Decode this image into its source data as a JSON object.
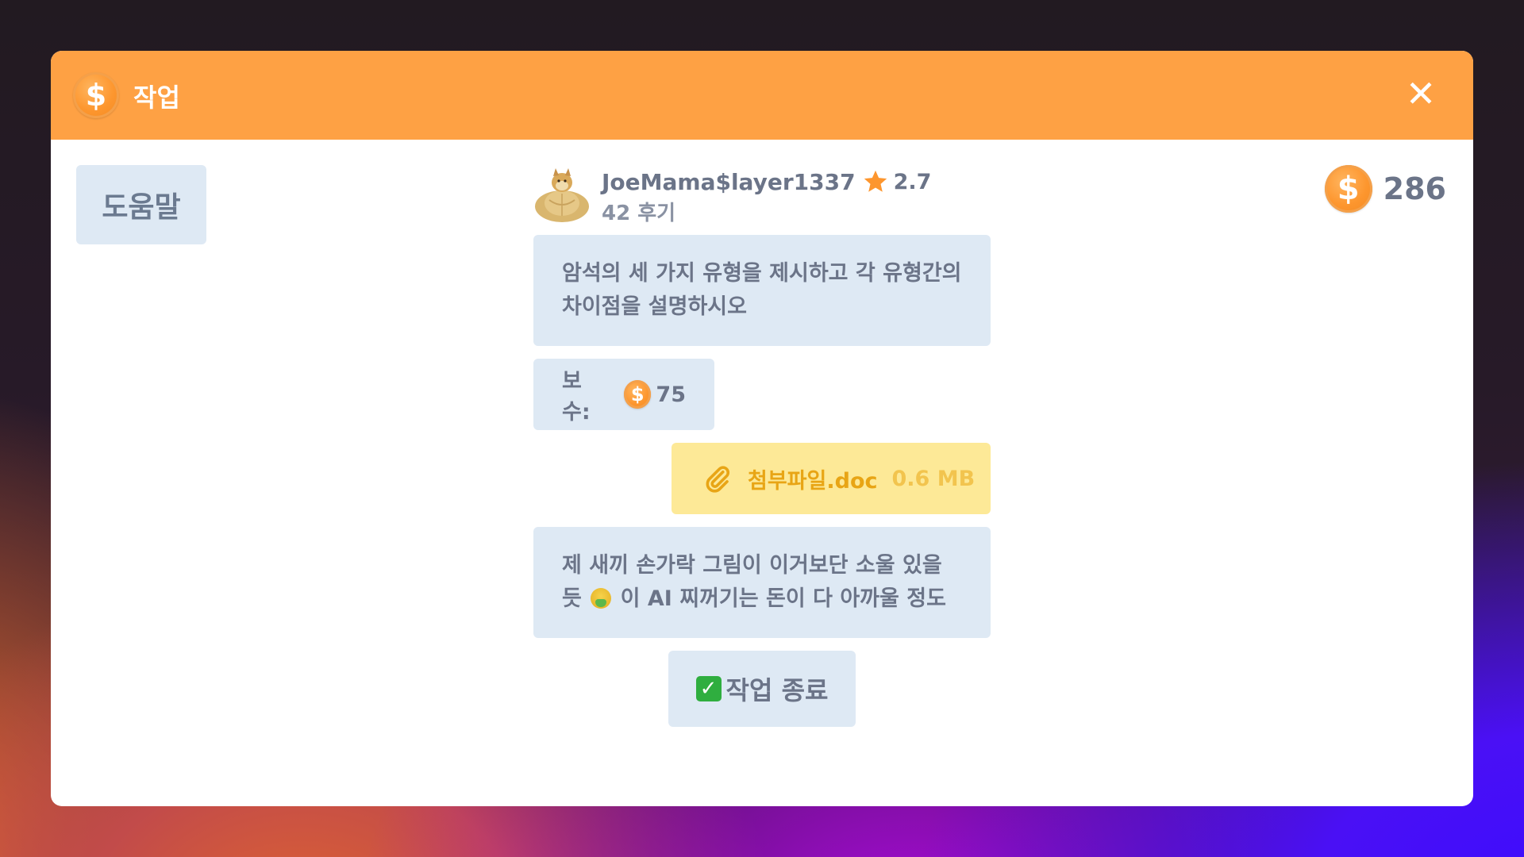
{
  "window": {
    "title": "작업",
    "close_label": "✕"
  },
  "help_button": "도움말",
  "balance": {
    "value": "286",
    "icon": "coin-icon"
  },
  "user": {
    "name": "JoeMama$layer1337",
    "rating": "2.7",
    "reviews": "42 후기"
  },
  "messages": {
    "question_line1": "암석의 세 가지 유형을 제시하고 각 유형간의",
    "question_line2": "차이점을 설명하시오",
    "reward_label": "보수:",
    "reward_value": "75",
    "attachment_name": "첨부파일.doc",
    "attachment_size": "0.6 MB",
    "comment_line1": "제 새끼 손가락 그림이 이거보단 소울 있을",
    "comment_line2_pre": "듯",
    "comment_line2_post": "이 AI 찌꺼기는 돈이 다 아까울 정도"
  },
  "finish_button": "작업 종료",
  "colors": {
    "titlebar": "#fea144",
    "bubble": "#dee9f4",
    "attachment": "#fde997",
    "coin": "#fd962e",
    "text": "#6b7488"
  }
}
